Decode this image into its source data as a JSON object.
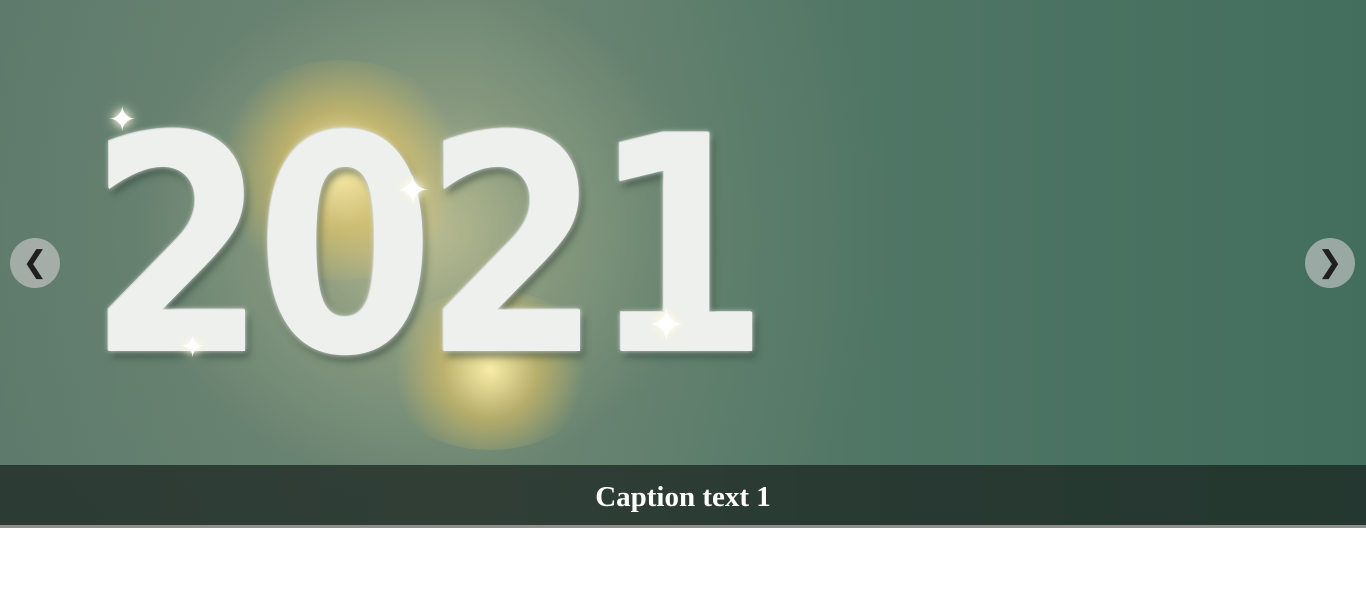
{
  "slideshow": {
    "slides": [
      {
        "image_text": "2021",
        "caption": "Caption text 1"
      }
    ],
    "prev_icon": "❮",
    "next_icon": "❯"
  },
  "colors": {
    "background_left": "#5d7a6c",
    "background_right": "#436e5d",
    "caption_bar": "#19231e",
    "caption_text": "#ffffff",
    "nav_button": "#c8c8c8"
  }
}
